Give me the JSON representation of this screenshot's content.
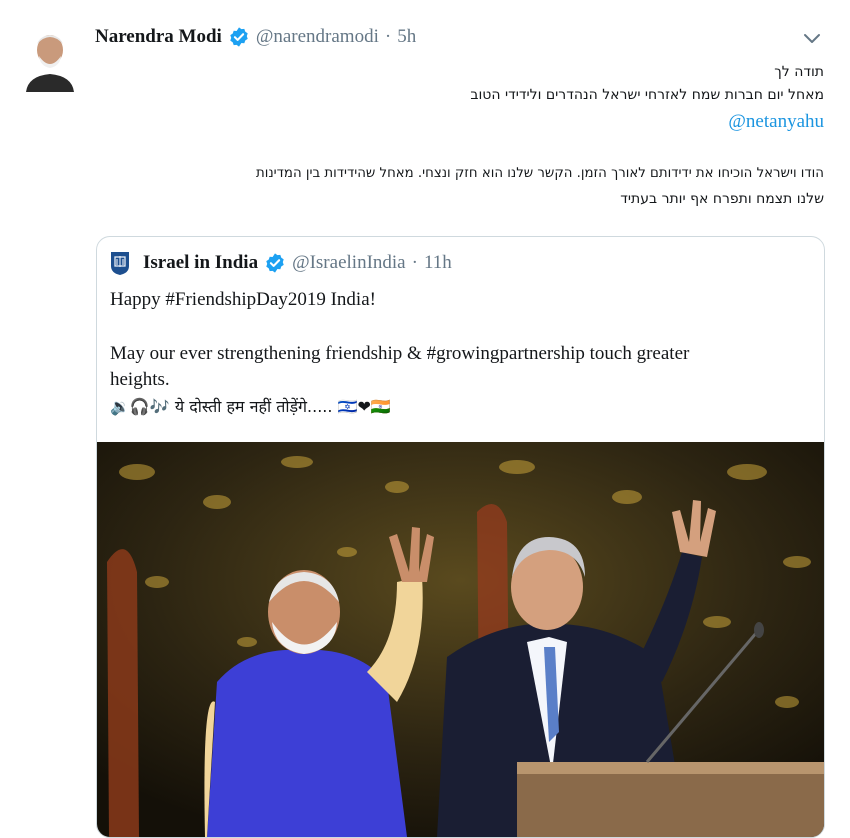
{
  "tweet": {
    "author_name": "Narendra Modi",
    "author_handle": "@narendramodi",
    "separator": "·",
    "time": "5h",
    "lines": [
      "תודה לך",
      "מאחל יום חברות  שמח לאזרחי ישראל הנהדרים ולידידי הטוב",
      "הודו וישראל הוכיחו את ידידותם לאורך הזמן. הקשר שלנו הוא חזק ונצחי. מאחל שהידידות בין המדינות",
      "שלנו תצמח ותפרח אף יותר בעתיד"
    ],
    "mention": "@netanyahu"
  },
  "quoted": {
    "author_name": "Israel in India",
    "author_handle": "@IsraelinIndia",
    "separator": "·",
    "time": "11h",
    "line1": "Happy #FriendshipDay2019 India!",
    "line2": "May our ever strengthening friendship & #growingpartnership touch greater",
    "line3": "heights.",
    "line4_emojis": "🔉🎧🎶",
    "line4_text": "ये दोस्ती हम नहीं तोड़ेंगे.....",
    "line4_tail": "🇮🇱❤🇮🇳"
  },
  "icons": {
    "verified": "verified-badge-icon",
    "chevron": "chevron-down-icon",
    "emblem": "israel-emblem-icon"
  },
  "colors": {
    "link": "#1b95e0",
    "verified": "#1da1f2",
    "muted": "#657786",
    "border": "#cfd9de"
  }
}
